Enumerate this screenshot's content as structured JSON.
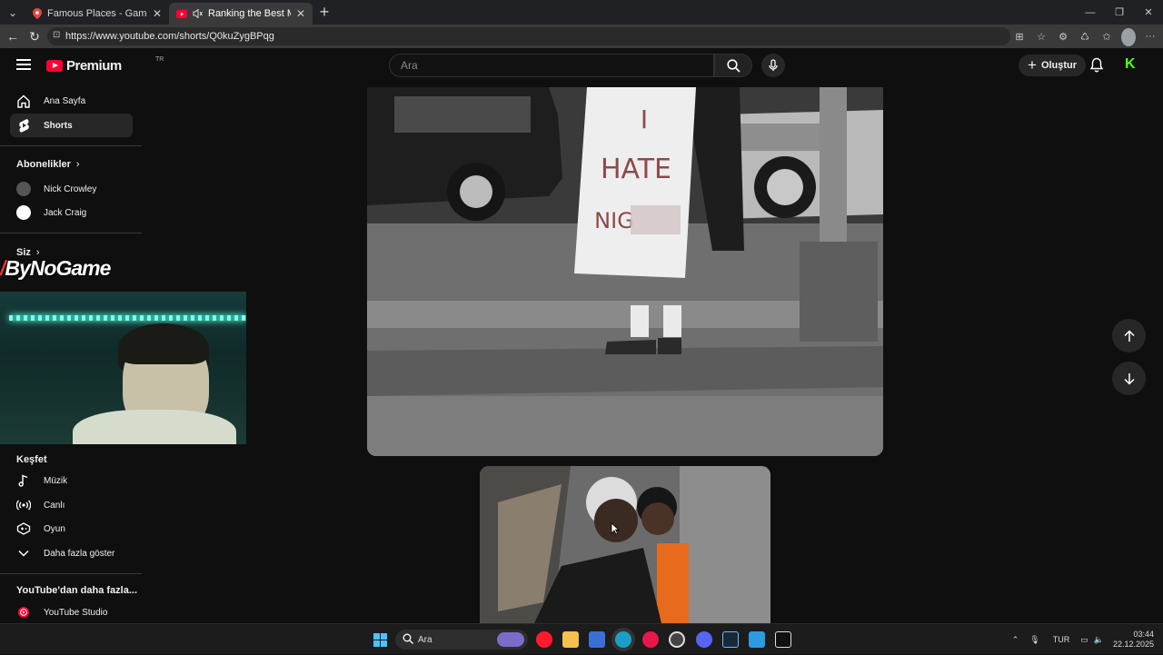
{
  "browser": {
    "tabs": [
      {
        "title": "Famous Places - Game - GeoGuessr",
        "favicon": "map-pin-icon",
        "active": false
      },
      {
        "title": "Ranking the Best Musical Chairs",
        "favicon": "youtube-icon",
        "active": true
      }
    ],
    "url": "https://www.youtube.com/shorts/Q0kuZygBPqg"
  },
  "youtube": {
    "brand": "Premium",
    "region": "TR",
    "search_placeholder": "Ara",
    "create_label": "Oluştur",
    "colors": {
      "accent": "#ff0033",
      "kick": "#53fc18"
    }
  },
  "sidebar": {
    "primary": [
      {
        "label": "Ana Sayfa",
        "icon": "home-icon"
      },
      {
        "label": "Shorts",
        "icon": "shorts-icon",
        "active": true
      }
    ],
    "subscriptions_title": "Abonelikler",
    "subscriptions": [
      {
        "label": "Nick Crowley"
      },
      {
        "label": "Jack Craig"
      }
    ],
    "you_title": "Siz",
    "explore_title": "Keşfet",
    "explore": [
      {
        "label": "Müzik",
        "icon": "music-icon"
      },
      {
        "label": "Canlı",
        "icon": "live-icon"
      },
      {
        "label": "Oyun",
        "icon": "gaming-icon"
      },
      {
        "label": "Daha fazla göster",
        "icon": "chevron-down-icon"
      }
    ],
    "more_title": "YouTube'dan daha fazla...",
    "more": [
      {
        "label": "YouTube Studio",
        "icon": "studio-icon"
      }
    ]
  },
  "overlay": {
    "logo_text": "ByNoGame"
  },
  "video": {
    "sign_text_1": "I",
    "sign_text_2": "HATE",
    "sign_text_3": "NIG"
  },
  "taskbar": {
    "search_label": "Ara",
    "language": "TUR",
    "time": "03:44",
    "date": "22.12.2025"
  }
}
